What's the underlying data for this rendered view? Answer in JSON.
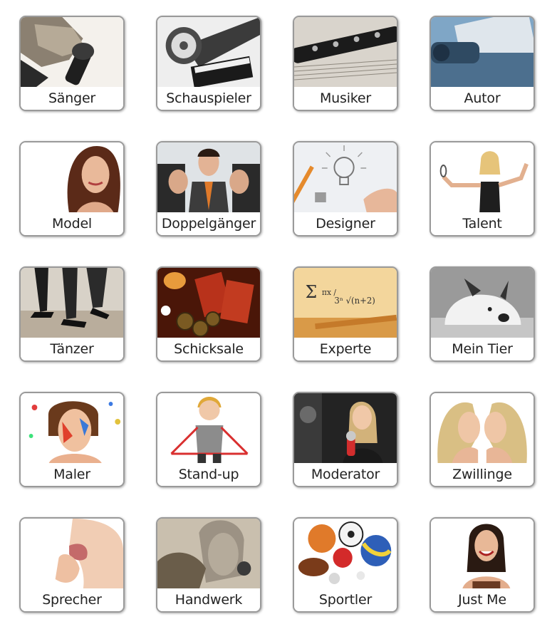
{
  "categories": [
    {
      "label": "Sänger",
      "icon": "microphone-icon"
    },
    {
      "label": "Schauspieler",
      "icon": "film-reel-icon"
    },
    {
      "label": "Musiker",
      "icon": "clarinet-icon"
    },
    {
      "label": "Autor",
      "icon": "typewriter-icon"
    },
    {
      "label": "Model",
      "icon": "model-portrait-icon"
    },
    {
      "label": "Doppelgänger",
      "icon": "lookalike-trio-icon"
    },
    {
      "label": "Designer",
      "icon": "lightbulb-sketch-icon"
    },
    {
      "label": "Talent",
      "icon": "juggling-woman-icon"
    },
    {
      "label": "Tänzer",
      "icon": "dancing-feet-icon"
    },
    {
      "label": "Schicksale",
      "icon": "fortune-coins-icon"
    },
    {
      "label": "Experte",
      "icon": "formula-icon"
    },
    {
      "label": "Mein Tier",
      "icon": "dog-icon"
    },
    {
      "label": "Maler",
      "icon": "painted-face-icon"
    },
    {
      "label": "Stand-up",
      "icon": "comedian-icon"
    },
    {
      "label": "Moderator",
      "icon": "reporter-microphone-icon"
    },
    {
      "label": "Zwillinge",
      "icon": "twins-icon"
    },
    {
      "label": "Sprecher",
      "icon": "shouting-mouth-icon"
    },
    {
      "label": "Handwerk",
      "icon": "sculpture-icon"
    },
    {
      "label": "Sportler",
      "icon": "sports-balls-icon"
    },
    {
      "label": "Just Me",
      "icon": "laughing-woman-icon"
    }
  ]
}
